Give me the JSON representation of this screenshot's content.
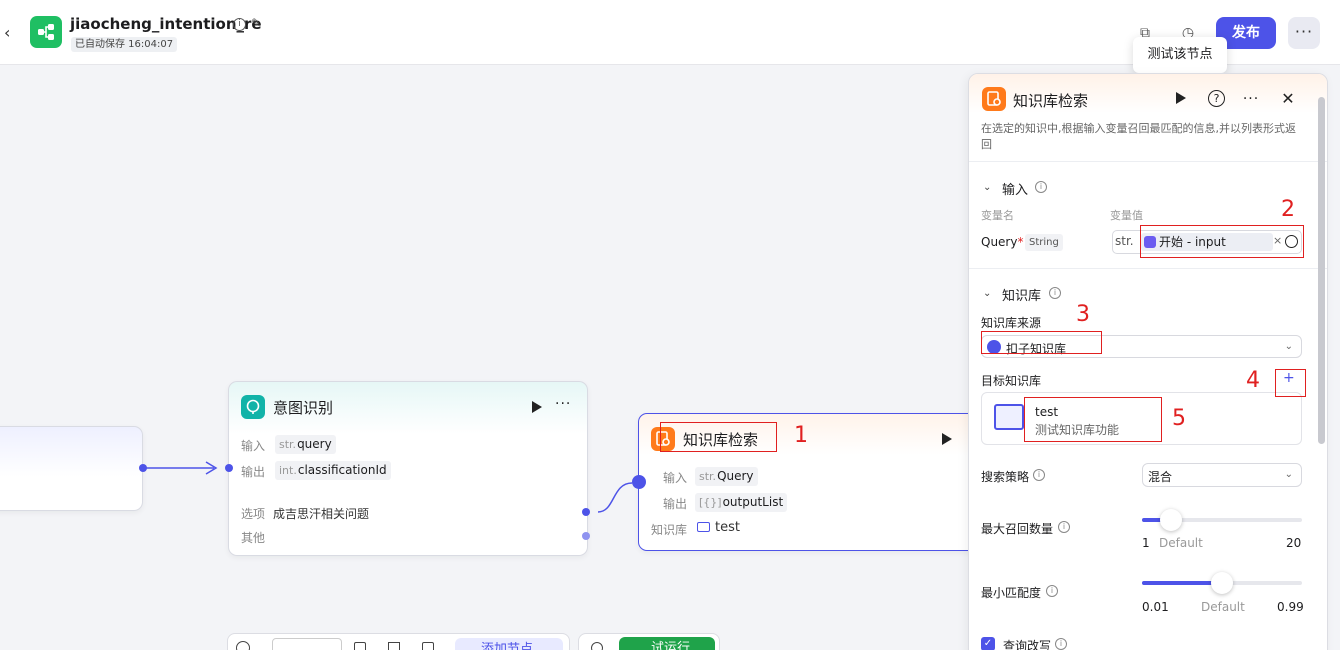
{
  "header": {
    "title": "jiaocheng_intention_re",
    "autosave": "已自动保存 16:04:07",
    "publish_label": "发布",
    "more_label": "···"
  },
  "tooltip": {
    "text": "测试该节点"
  },
  "canvas": {
    "intent_node": {
      "title": "意图识别",
      "input_label": "输入",
      "input_type": "str.",
      "input_value": "query",
      "output_label": "输出",
      "output_type": "int.",
      "output_value": "classificationId",
      "option_label": "选项",
      "option_value": "成吉思汗相关问题",
      "other_label": "其他"
    },
    "kb_node": {
      "title": "知识库检索",
      "input_label": "输入",
      "input_type": "str.",
      "input_value": "Query",
      "output_label": "输出",
      "output_type": "[{}]",
      "output_value": "outputList",
      "kb_label": "知识库",
      "kb_value": "test"
    },
    "toolbar": {
      "add_node_label": "添加节点",
      "run_label": "试运行"
    }
  },
  "panel": {
    "title": "知识库检索",
    "description": "在选定的知识中,根据输入变量召回最匹配的信息,并以列表形式返回",
    "input_section": {
      "title": "输入",
      "var_name_header": "变量名",
      "var_value_header": "变量值",
      "var_name": "Query",
      "required_mark": "*",
      "var_type": "String",
      "value_type": "str.",
      "value_ref": "开始 - input",
      "clear": "×"
    },
    "kb_section": {
      "title": "知识库",
      "source_label": "知识库来源",
      "source_value": "扣子知识库",
      "target_label": "目标知识库",
      "add_label": "+",
      "kb_name": "test",
      "kb_desc": "测试知识库功能"
    },
    "search": {
      "strategy_label": "搜索策略",
      "strategy_value": "混合",
      "max_recall_label": "最大召回数量",
      "max_recall_min": "1",
      "max_recall_default": "Default",
      "max_recall_max": "20",
      "max_recall_fraction": 0.18,
      "min_match_label": "最小匹配度",
      "min_match_min": "0.01",
      "min_match_default": "Default",
      "min_match_max": "0.99",
      "min_match_fraction": 0.5,
      "rewrite_label": "查询改写"
    }
  },
  "annotations": [
    "1",
    "2",
    "3",
    "4",
    "5"
  ],
  "colors": {
    "accent": "#4d53e8",
    "annotation": "#e02020",
    "kb_icon": "#ff7a1a",
    "intent_icon": "#12b3a8",
    "logo": "#1fbf63"
  }
}
